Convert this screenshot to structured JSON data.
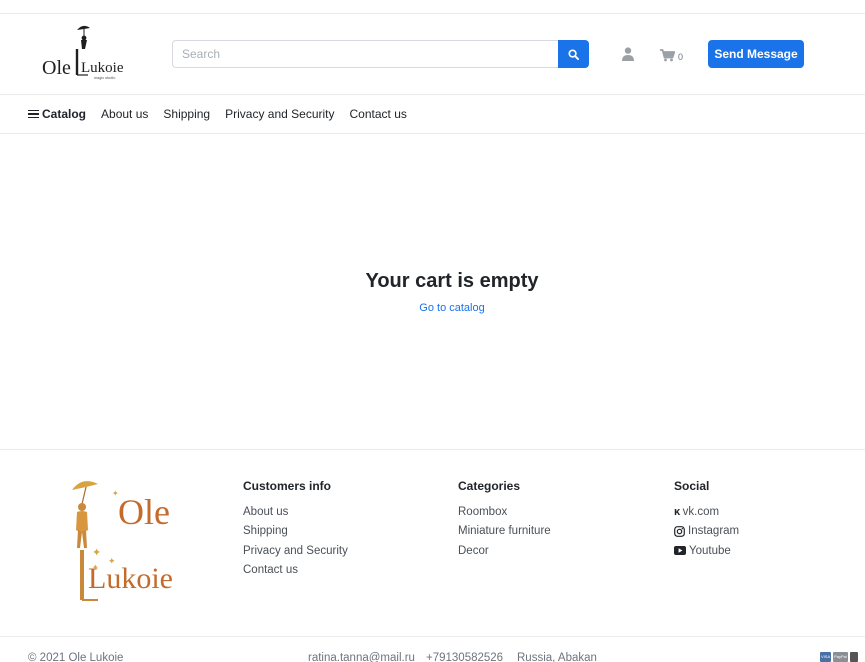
{
  "header": {
    "logo": {
      "line1": "Ole",
      "line2": "Lukoie",
      "tagline": "magic studio"
    },
    "search_placeholder": "Search",
    "cart_count": "0",
    "send_message": "Send Message"
  },
  "nav": {
    "catalog": "Catalog",
    "items": [
      "About us",
      "Shipping",
      "Privacy and Security",
      "Contact us"
    ]
  },
  "main": {
    "title": "Your cart is empty",
    "link": "Go to catalog"
  },
  "footer": {
    "logo": {
      "line1": "Ole",
      "line2": "Lukoie"
    },
    "customers": {
      "title": "Customers info",
      "items": [
        "About us",
        "Shipping",
        "Privacy and Security",
        "Contact us"
      ]
    },
    "categories": {
      "title": "Categories",
      "items": [
        "Roombox",
        "Miniature furniture",
        "Decor"
      ]
    },
    "social": {
      "title": "Social",
      "items": [
        "vk.com",
        "Instagram",
        "Youtube"
      ]
    },
    "bottom": {
      "copyright": "© 2021 Ole Lukoie",
      "email": "ratina.tanna@mail.ru",
      "phone": "+79130582526",
      "location": "Russia, Abakan"
    },
    "payments": [
      "VISA",
      "PayPal"
    ]
  },
  "colors": {
    "accent": "#1a73e8",
    "logo_gold": "#d08a3a",
    "logo_dark": "#1f1f1f"
  }
}
